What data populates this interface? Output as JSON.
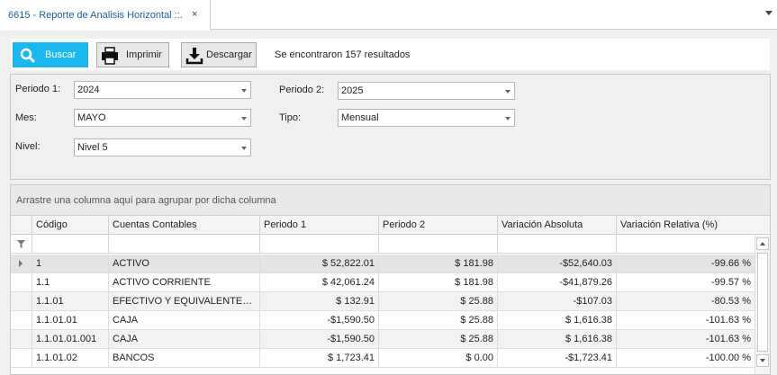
{
  "tab": {
    "title": "6615 - Reporte de Analisis Horizontal ::.",
    "close": "×"
  },
  "toolbar": {
    "buscar": "Buscar",
    "imprimir": "Imprimir",
    "descargar": "Descargar",
    "results": "Se encontraron 157 resultados"
  },
  "filters": {
    "periodo1_label": "Periodo 1:",
    "periodo1_value": "2024",
    "periodo2_label": "Periodo 2:",
    "periodo2_value": "2025",
    "mes_label": "Mes:",
    "mes_value": "MAYO",
    "tipo_label": "Tipo:",
    "tipo_value": "Mensual",
    "nivel_label": "Nivel:",
    "nivel_value": "Nivel 5"
  },
  "grid": {
    "group_hint": "Arrastre una columna aquí para agrupar por dicha columna",
    "columns": [
      "Código",
      "Cuentas Contables",
      "Periodo 1",
      "Periodo 2",
      "Variación Absoluta",
      "Variación Relativa (%)"
    ],
    "rows": [
      [
        "1",
        "ACTIVO",
        "$ 52,822.01",
        "$ 181.98",
        "-$52,640.03",
        "-99.66 %"
      ],
      [
        "1.1",
        "ACTIVO CORRIENTE",
        "$ 42,061.24",
        "$ 181.98",
        "-$41,879.26",
        "-99.57 %"
      ],
      [
        "1.1.01",
        "EFECTIVO Y EQUIVALENTES AL...",
        "$ 132.91",
        "$ 25.88",
        "-$107.03",
        "-80.53 %"
      ],
      [
        "1.1.01.01",
        "CAJA",
        "-$1,590.50",
        "$ 25.88",
        "$ 1,616.38",
        "-101.63 %"
      ],
      [
        "1.1.01.01.001",
        "CAJA",
        "-$1,590.50",
        "$ 25.88",
        "$ 1,616.38",
        "-101.63 %"
      ],
      [
        "1.1.01.02",
        "BANCOS",
        "$ 1,723.41",
        "$ 0.00",
        "-$1,723.41",
        "-100.00 %"
      ]
    ]
  },
  "colors": {
    "accent": "#1ab8ef",
    "tab_text": "#1f5fa8",
    "selected_row": "#e4e4e4"
  }
}
